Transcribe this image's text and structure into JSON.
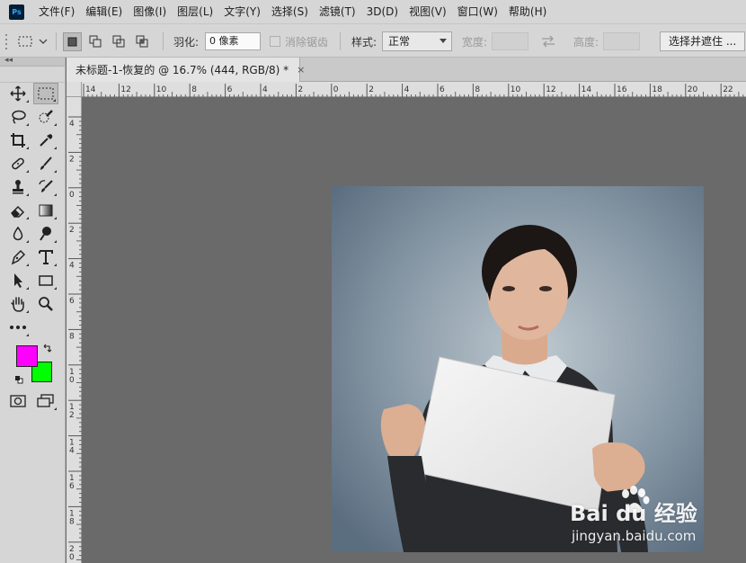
{
  "app": {
    "icon_text": "Ps"
  },
  "menu": [
    "文件(F)",
    "编辑(E)",
    "图像(I)",
    "图层(L)",
    "文字(Y)",
    "选择(S)",
    "滤镜(T)",
    "3D(D)",
    "视图(V)",
    "窗口(W)",
    "帮助(H)"
  ],
  "options": {
    "feather_label": "羽化:",
    "feather_value": "0 像素",
    "antialias_label": "消除锯齿",
    "style_label": "样式:",
    "style_value": "正常",
    "width_label": "宽度:",
    "height_label": "高度:",
    "select_mask_button": "选择并遮住 ..."
  },
  "toolbar": {
    "collapse_glyph": "◂◂",
    "foreground_color": "#ff00ff",
    "background_color": "#00ff00"
  },
  "document": {
    "tab_title": "未标题-1-恢复的 @ 16.7% (444, RGB/8) *",
    "close_glyph": "×"
  },
  "rulers": {
    "horizontal_labels": [
      "14",
      "12",
      "10",
      "8",
      "6",
      "4",
      "2",
      "0",
      "2",
      "4",
      "6",
      "8",
      "10",
      "12",
      "14",
      "16",
      "18",
      "20",
      "22"
    ],
    "vertical_labels": [
      "4",
      "2",
      "0",
      "2",
      "4",
      "6",
      "8",
      "1 0",
      "1 2",
      "1 4",
      "1 6",
      "1 8",
      "2 0"
    ]
  },
  "watermark": {
    "main": "Bai du 经验",
    "sub": "jingyan.baidu.com"
  }
}
